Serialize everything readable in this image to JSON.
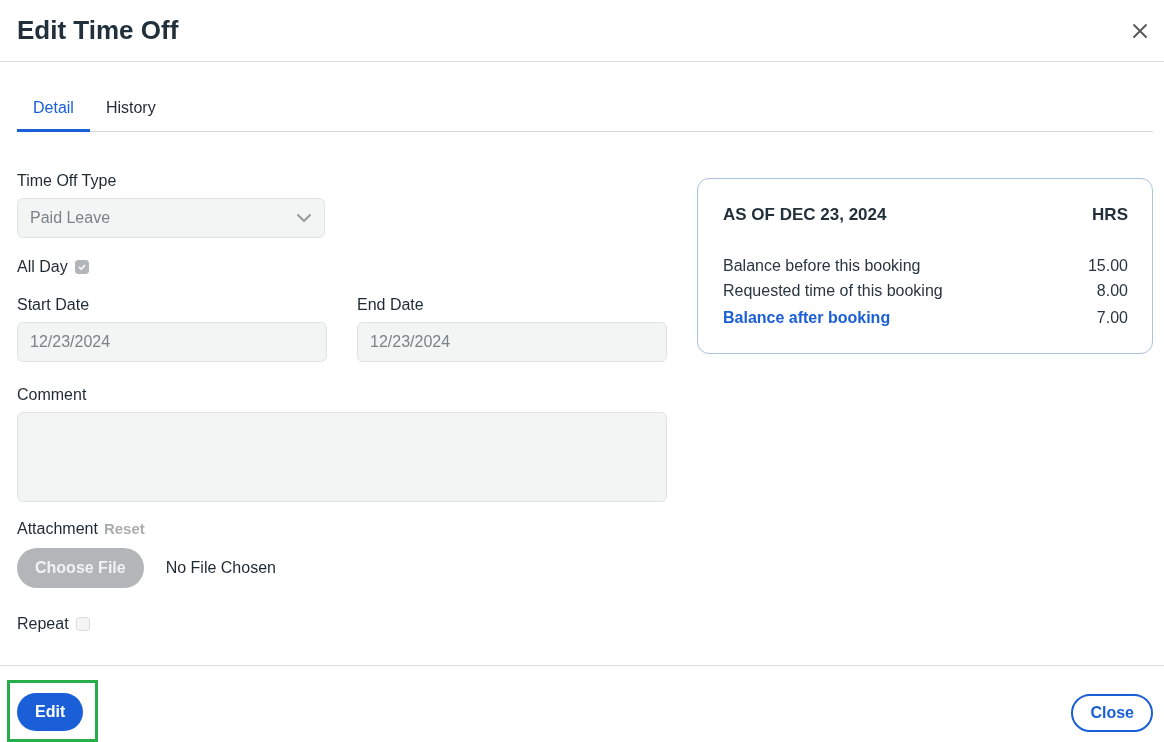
{
  "dialog": {
    "title": "Edit Time Off"
  },
  "tabs": [
    {
      "label": "Detail",
      "selected": true
    },
    {
      "label": "History",
      "selected": false
    }
  ],
  "form": {
    "time_off_type": {
      "label": "Time Off Type",
      "value": "Paid Leave",
      "disabled": true
    },
    "all_day": {
      "label": "All Day",
      "checked": true,
      "disabled": true
    },
    "start_date": {
      "label": "Start Date",
      "value": "12/23/2024",
      "disabled": true
    },
    "end_date": {
      "label": "End Date",
      "value": "12/23/2024",
      "disabled": true
    },
    "comment": {
      "label": "Comment",
      "disabled": true
    },
    "attachment": {
      "label": "Attachment",
      "reset": "Reset",
      "button": "Choose File",
      "status": "No File Chosen",
      "disabled": true
    },
    "repeat": {
      "label": "Repeat",
      "checked": false,
      "disabled": true
    }
  },
  "balance": {
    "heading": "AS OF DEC 23, 2024",
    "unit": "HRS",
    "rows": [
      {
        "label": "Balance before this booking",
        "value": "15.00",
        "kind": "line"
      },
      {
        "label": "Requested time of this booking",
        "value": "8.00",
        "kind": "line"
      },
      {
        "label": "Balance after booking",
        "value": "7.00",
        "kind": "total"
      }
    ]
  },
  "footer": {
    "edit": {
      "label": "Edit",
      "highlighted": true
    },
    "close": {
      "label": "Close"
    }
  }
}
